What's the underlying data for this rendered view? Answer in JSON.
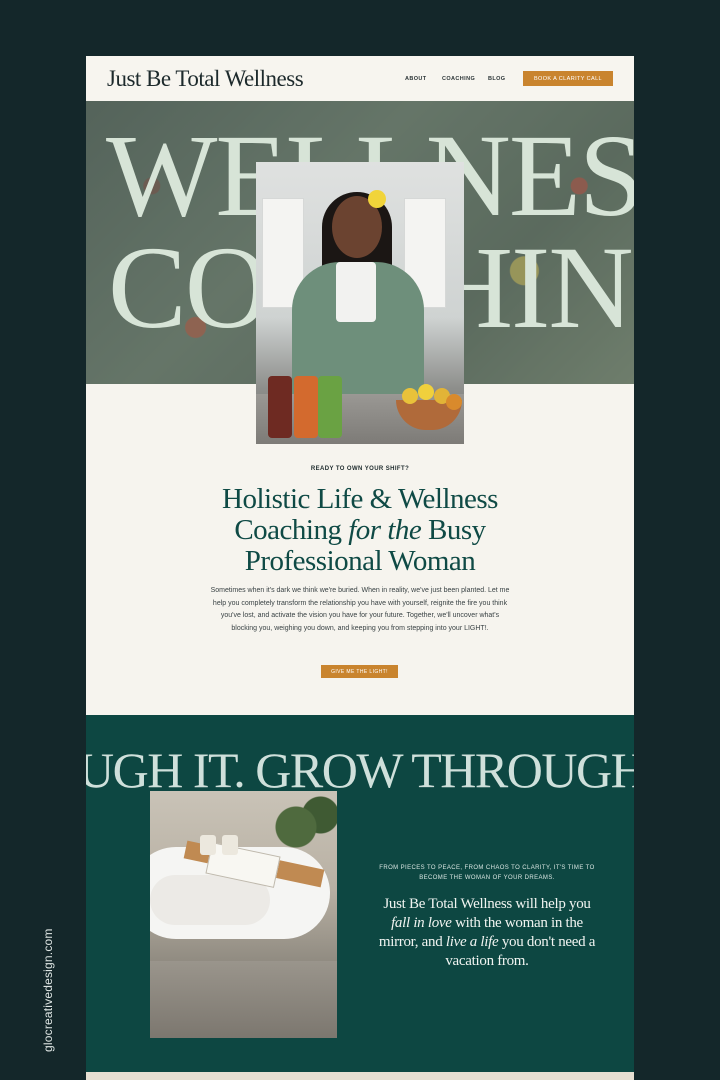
{
  "header": {
    "logo": "Just Be Total Wellness",
    "nav": [
      "ABOUT",
      "COACHING",
      "BLOG"
    ],
    "cta": "BOOK A CLARITY CALL"
  },
  "hero": {
    "line1": "WELLNESS",
    "line2": "COACHING"
  },
  "intro": {
    "eyebrow": "READY TO OWN YOUR SHIFT?",
    "headline_part1": "Holistic Life & Wellness",
    "headline_part2": "Coaching ",
    "headline_italic": "for the",
    "headline_part3": " Busy",
    "headline_part4": "Professional Woman",
    "body": "Sometimes when it's dark we think we're buried. When in reality, we've just been planted. Let me help you completely transform the relationship you have with yourself, reignite the fire you think you've lost, and activate the vision you have for your future. Together, we'll uncover what's blocking you, weighing you down, and keeping you from stepping into your LIGHT!.",
    "cta": "GIVE ME THE LIGHT!"
  },
  "section2": {
    "marquee": "UGH IT.   GROW THROUGH",
    "eyebrow": "FROM PIECES TO PEACE, FROM CHAOS TO CLARITY, IT'S TIME TO BECOME THE WOMAN OF YOUR DREAMS.",
    "quote_1": "Just Be Total Wellness will help you ",
    "quote_italic_1": "fall in love",
    "quote_2": " with the woman in the mirror, and ",
    "quote_italic_2": "live a life",
    "quote_3": " you don't need a vacation from."
  },
  "credit": "glocreativedesign.com",
  "colors": {
    "background": "#14272a",
    "accent": "#c9842e",
    "dark_green": "#0d4742",
    "headline_green": "#0f4a45",
    "cream": "#f6f4ee"
  }
}
